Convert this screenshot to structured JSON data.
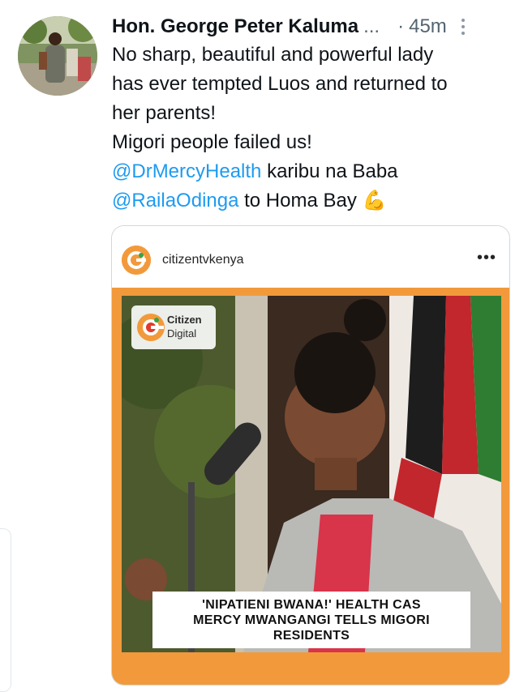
{
  "tweet": {
    "author_name": "Hon. George Peter Kaluma",
    "name_truncation": "...",
    "separator": "·",
    "timestamp": "45m",
    "text_lines": [
      "No sharp, beautiful and powerful lady",
      "has ever tempted Luos and returned to",
      "her parents!",
      "Migori people failed us!"
    ],
    "mention_1": "@DrMercyHealth",
    "after_mention_1": " karibu na Baba",
    "mention_2": "@RailaOdinga",
    "after_mention_2": " to Homa Bay",
    "emoji": "💪"
  },
  "embed": {
    "account": "citizentvkenya",
    "more": "•••",
    "logo_text_1": "Citizen",
    "logo_text_2": "Digital",
    "headline": "'NIPATIENI BWANA!' HEALTH CAS\nMERCY MWANGANGI TELLS MIGORI\nRESIDENTS"
  },
  "colors": {
    "link": "#1d9bf0",
    "frame_orange": "#f29a3b",
    "text": "#0f1419",
    "muted": "#536471"
  },
  "icons": [
    "more-options-icon",
    "flexed-biceps-emoji",
    "citizen-digital-logo-icon"
  ]
}
